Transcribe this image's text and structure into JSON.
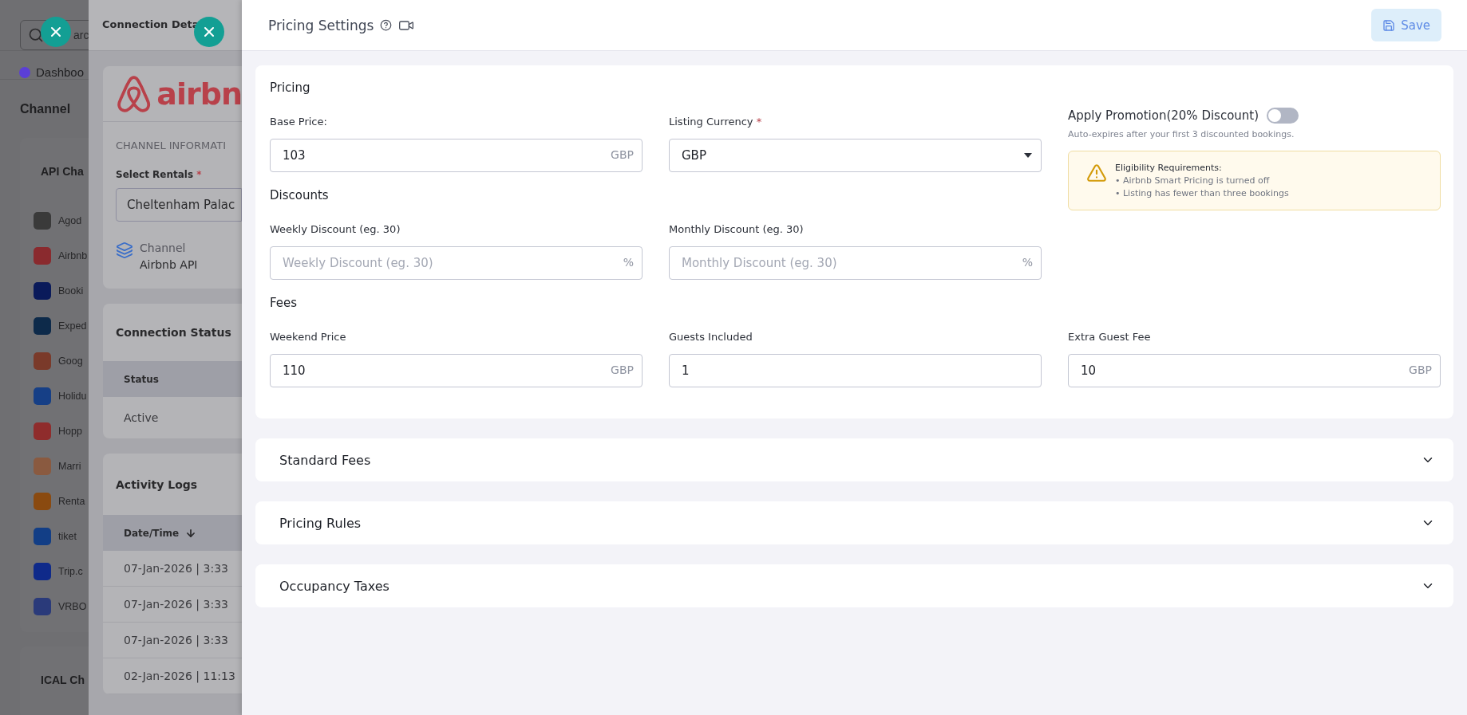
{
  "background_page": {
    "search": {
      "placeholder": "arc"
    },
    "nav": [
      {
        "label": "Dashboo",
        "color": "#5b3fd6"
      }
    ],
    "section_title": "Channel",
    "api_group": {
      "title": "API Cha",
      "channels": [
        {
          "name": "Agod",
          "color": "#3a3a3a"
        },
        {
          "name": "Airbnb",
          "color": "#8a2a2e"
        },
        {
          "name": "Booki",
          "color": "#0a1a5a"
        },
        {
          "name": "Exped",
          "color": "#0d2a4a"
        },
        {
          "name": "Goog",
          "color": "#7a3a2a"
        },
        {
          "name": "Holidu",
          "color": "#163f86"
        },
        {
          "name": "Hopp",
          "color": "#8f2c2c"
        },
        {
          "name": "Marri",
          "color": "#8a5a40"
        },
        {
          "name": "Renta",
          "color": "#8a4a10"
        },
        {
          "name": "tiket",
          "color": "#123e86"
        },
        {
          "name": "Trip.c",
          "color": "#0f2a8a"
        },
        {
          "name": "VRBO",
          "color": "#2a3a7a"
        }
      ]
    },
    "ical_group": {
      "title": "ICAL Ch"
    }
  },
  "connection_drawer": {
    "title": "Connection Deta",
    "logo_text": "airbn",
    "channel_information": {
      "heading": "CHANNEL INFORMATI",
      "select_label": "Select Rentals",
      "required_mark": "*",
      "select_value": "Cheltenham Palac",
      "channel_label": "Channel",
      "channel_value": "Airbnb API"
    },
    "connection_status": {
      "title": "Connection Status",
      "column": "Status",
      "value": "Active"
    },
    "activity_logs": {
      "title": "Activity Logs",
      "column": "Date/Time",
      "rows": [
        "07-Jan-2026 | 3:33",
        "07-Jan-2026 | 3:33",
        "07-Jan-2026 | 3:33",
        "02-Jan-2026 | 11:13"
      ]
    }
  },
  "pricing_settings": {
    "title": "Pricing Settings",
    "save_label": "Save",
    "pricing": {
      "title": "Pricing",
      "base_price": {
        "label": "Base Price:",
        "value": "103",
        "suffix": "GBP"
      },
      "listing_currency": {
        "label": "Listing Currency",
        "value": "GBP",
        "required_mark": "*"
      },
      "promotion": {
        "label": "Apply Promotion(20% Discount)",
        "on": false,
        "note": "Auto-expires after your first 3 discounted bookings.",
        "alert": {
          "title": "Eligibility Requirements:",
          "items": [
            "• Airbnb Smart Pricing is turned off",
            "• Listing has fewer than three bookings"
          ]
        }
      },
      "discounts_title": "Discounts",
      "weekly_discount": {
        "label": "Weekly Discount (eg. 30)",
        "placeholder": "Weekly Discount (eg. 30)",
        "suffix": "%"
      },
      "monthly_discount": {
        "label": "Monthly Discount (eg. 30)",
        "placeholder": "Monthly Discount (eg. 30)",
        "suffix": "%"
      },
      "fees_title": "Fees",
      "weekend_price": {
        "label": "Weekend Price",
        "value": "110",
        "suffix": "GBP"
      },
      "guests_included": {
        "label": "Guests Included",
        "value": "1"
      },
      "extra_guest_fee": {
        "label": "Extra Guest Fee",
        "value": "10",
        "suffix": "GBP"
      }
    },
    "accordions": [
      {
        "title": "Standard Fees",
        "expanded": false
      },
      {
        "title": "Pricing Rules",
        "expanded": false
      },
      {
        "title": "Occupancy Taxes",
        "expanded": false
      }
    ]
  }
}
